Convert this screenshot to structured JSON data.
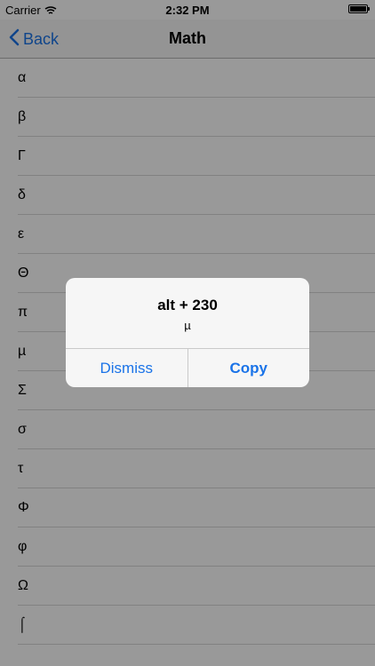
{
  "status_bar": {
    "carrier": "Carrier",
    "time": "2:32 PM"
  },
  "nav": {
    "back_label": "Back",
    "title": "Math"
  },
  "list": {
    "items": [
      "α",
      "β",
      "Γ",
      "δ",
      "ε",
      "Θ",
      "π",
      "µ",
      "Σ",
      "σ",
      "τ",
      "Φ",
      "φ",
      "Ω",
      "⌠"
    ]
  },
  "alert": {
    "title": "alt + 230",
    "message": "µ",
    "dismiss_label": "Dismiss",
    "copy_label": "Copy"
  },
  "colors": {
    "accent": "#1a73e8",
    "overlay": "rgba(0,0,0,0.40)"
  },
  "icons": {
    "wifi": "wifi-icon",
    "battery": "battery-icon",
    "back": "chevron-left-icon"
  }
}
